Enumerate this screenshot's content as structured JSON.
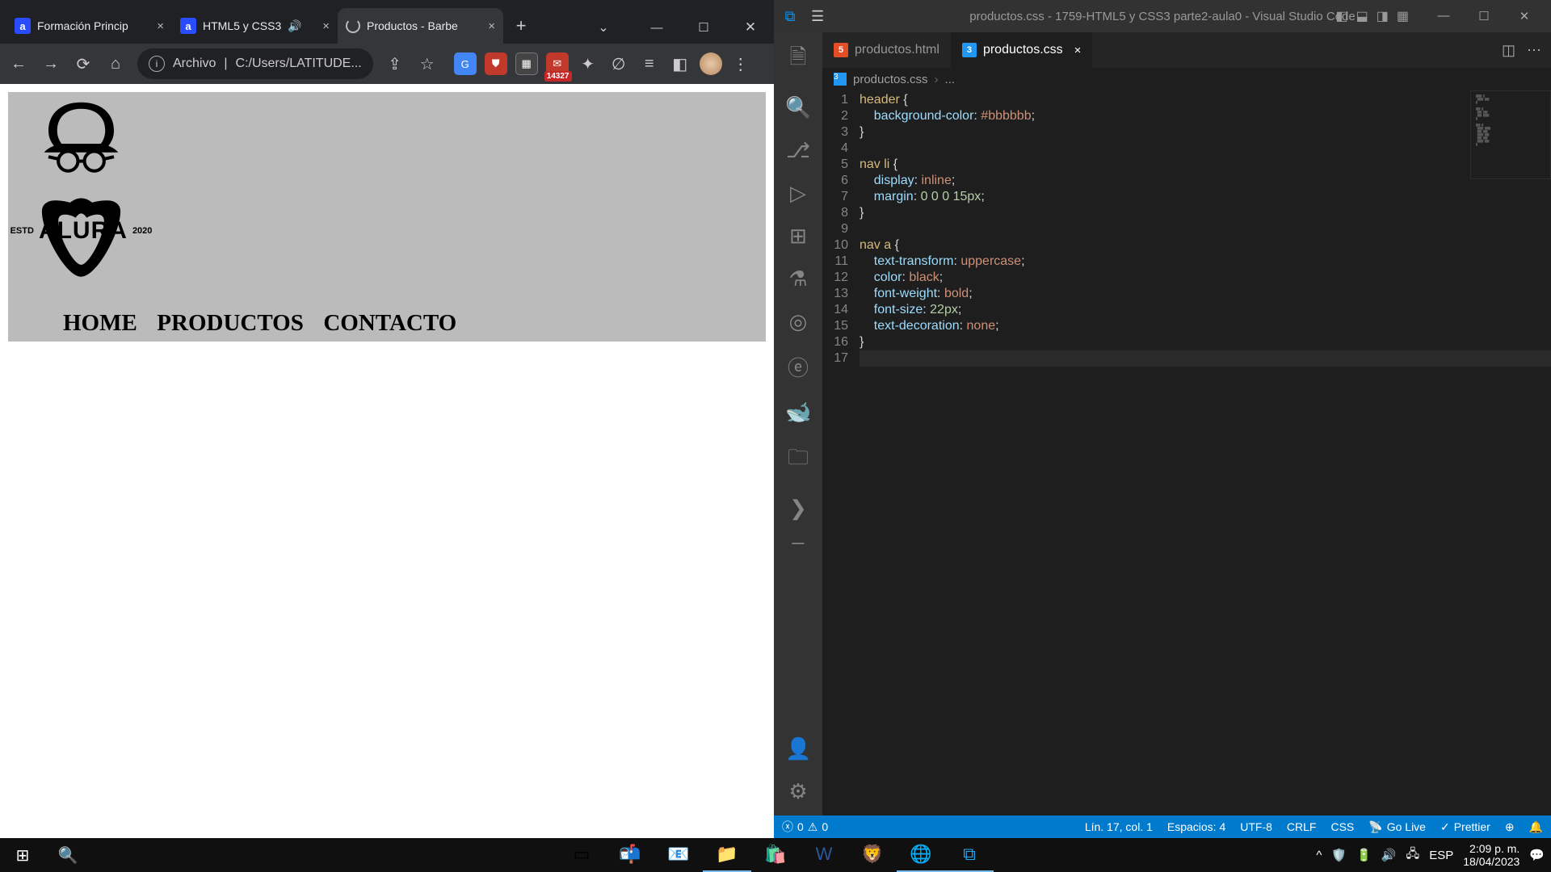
{
  "browser": {
    "tabs": [
      {
        "label": "Formación Princip",
        "favicon": "a",
        "audio": false,
        "active": false
      },
      {
        "label": "HTML5 y CSS3",
        "favicon": "a",
        "audio": true,
        "active": false
      },
      {
        "label": "Productos - Barbe",
        "favicon": "loading",
        "audio": false,
        "active": true
      }
    ],
    "url_scheme": "Archivo",
    "url": "C:/Users/LATITUDE...",
    "mail_badge": "14327",
    "page": {
      "logo_top": "ALURA",
      "logo_left": "ESTD",
      "logo_right": "2020",
      "nav": [
        {
          "label": "HOME"
        },
        {
          "label": "PRODUCTOS"
        },
        {
          "label": "CONTACTO"
        }
      ]
    }
  },
  "vscode": {
    "title": "productos.css - 1759-HTML5 y CSS3 parte2-aula0 - Visual Studio Code",
    "tabs": [
      {
        "name": "productos.html",
        "type": "html",
        "active": false
      },
      {
        "name": "productos.css",
        "type": "css",
        "active": true
      }
    ],
    "breadcrumb_file": "productos.css",
    "breadcrumb_more": "...",
    "code": [
      {
        "n": 1,
        "t": [
          [
            "sel",
            "header "
          ],
          [
            "punc",
            "{"
          ]
        ]
      },
      {
        "n": 2,
        "t": [
          [
            "ind",
            "    "
          ],
          [
            "prop",
            "background-color"
          ],
          [
            "punc",
            ": "
          ],
          [
            "val",
            "#bbbbbb"
          ],
          [
            "punc",
            ";"
          ]
        ]
      },
      {
        "n": 3,
        "t": [
          [
            "punc",
            "}"
          ]
        ]
      },
      {
        "n": 4,
        "t": []
      },
      {
        "n": 5,
        "t": [
          [
            "sel",
            "nav li "
          ],
          [
            "punc",
            "{"
          ]
        ]
      },
      {
        "n": 6,
        "t": [
          [
            "ind",
            "    "
          ],
          [
            "prop",
            "display"
          ],
          [
            "punc",
            ": "
          ],
          [
            "val",
            "inline"
          ],
          [
            "punc",
            ";"
          ]
        ]
      },
      {
        "n": 7,
        "t": [
          [
            "ind",
            "    "
          ],
          [
            "prop",
            "margin"
          ],
          [
            "punc",
            ": "
          ],
          [
            "num",
            "0 0 0 15px"
          ],
          [
            "punc",
            ";"
          ]
        ]
      },
      {
        "n": 8,
        "t": [
          [
            "punc",
            "}"
          ]
        ]
      },
      {
        "n": 9,
        "t": []
      },
      {
        "n": 10,
        "t": [
          [
            "sel",
            "nav a "
          ],
          [
            "punc",
            "{"
          ]
        ]
      },
      {
        "n": 11,
        "t": [
          [
            "ind",
            "    "
          ],
          [
            "prop",
            "text-transform"
          ],
          [
            "punc",
            ": "
          ],
          [
            "val",
            "uppercase"
          ],
          [
            "punc",
            ";"
          ]
        ]
      },
      {
        "n": 12,
        "t": [
          [
            "ind",
            "    "
          ],
          [
            "prop",
            "color"
          ],
          [
            "punc",
            ": "
          ],
          [
            "val",
            "black"
          ],
          [
            "punc",
            ";"
          ]
        ]
      },
      {
        "n": 13,
        "t": [
          [
            "ind",
            "    "
          ],
          [
            "prop",
            "font-weight"
          ],
          [
            "punc",
            ": "
          ],
          [
            "val",
            "bold"
          ],
          [
            "punc",
            ";"
          ]
        ]
      },
      {
        "n": 14,
        "t": [
          [
            "ind",
            "    "
          ],
          [
            "prop",
            "font-size"
          ],
          [
            "punc",
            ": "
          ],
          [
            "num",
            "22px"
          ],
          [
            "punc",
            ";"
          ]
        ]
      },
      {
        "n": 15,
        "t": [
          [
            "ind",
            "    "
          ],
          [
            "prop",
            "text-decoration"
          ],
          [
            "punc",
            ": "
          ],
          [
            "val",
            "none"
          ],
          [
            "punc",
            ";"
          ]
        ]
      },
      {
        "n": 16,
        "t": [
          [
            "punc",
            "}"
          ]
        ]
      },
      {
        "n": 17,
        "t": [],
        "hl": true
      }
    ],
    "status": {
      "errors": "0",
      "warnings": "0",
      "pos": "Lín. 17, col. 1",
      "spaces": "Espacios: 4",
      "enc": "UTF-8",
      "eol": "CRLF",
      "lang": "CSS",
      "live": "Go Live",
      "fmt": "Prettier"
    }
  },
  "taskbar": {
    "lang": "ESP",
    "time": "2:09 p. m.",
    "date": "18/04/2023"
  }
}
